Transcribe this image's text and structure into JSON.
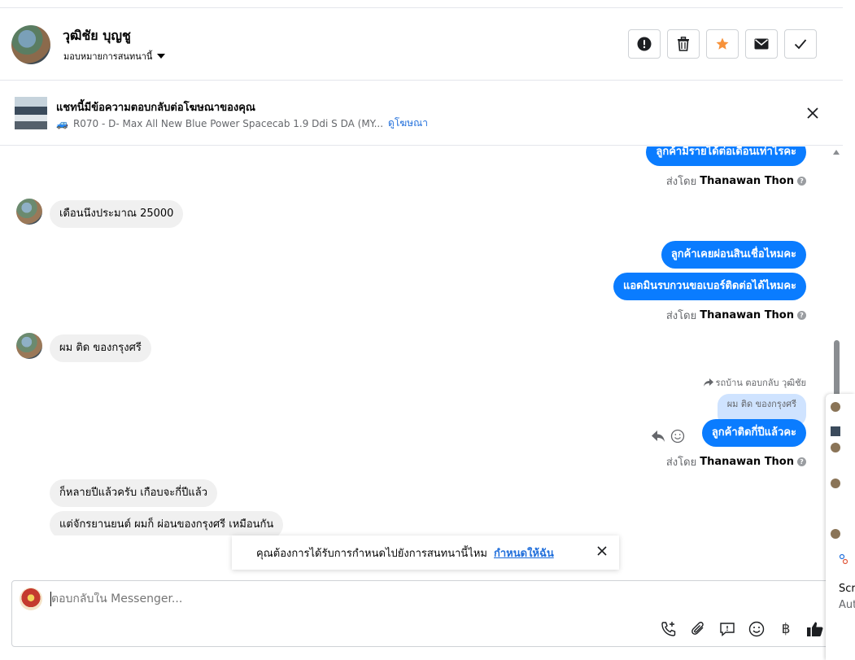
{
  "header": {
    "contact_name": "วุฒิชัย บุญชู",
    "assign_label": "มอบหมายการสนทนานี้",
    "actions": [
      {
        "name": "report-button",
        "icon": "exclamation-circle-icon"
      },
      {
        "name": "delete-button",
        "icon": "trash-icon"
      },
      {
        "name": "star-button",
        "icon": "star-icon"
      },
      {
        "name": "mark-unread-button",
        "icon": "envelope-icon"
      },
      {
        "name": "done-button",
        "icon": "check-icon"
      }
    ]
  },
  "ad_banner": {
    "title": "แชทนี้มีข้อความตอบกลับต่อโฆษณาของคุณ",
    "ad_text": "R070 - D- Max All New Blue Power Spacecab 1.9 Ddi S DA (MY...",
    "view_ad_link": "ดูโฆษณา"
  },
  "messages": {
    "m1_out": "ลูกค้ามีรายได้ต่อเดือนเท่าไรคะ",
    "sent_by_prefix": "ส่งโดย",
    "sent_by_name": "Thanawan Thon",
    "m2_in": "เดือนนึงประมาณ 25000",
    "m3_out": "ลูกค้าเคยผ่อนสินเชื่อไหมคะ",
    "m4_out": "แอดมินรบกวนขอเบอร์ติดต่อได้ไหมคะ",
    "m5_in": "ผม ติด ของกรุงศรี",
    "reply_label": "รถบ้าน ตอบกลับ วุฒิชัย",
    "quoted_text": "ผม ติด ของกรุงศรี",
    "m6_out": "ลูกค้าติดกี่ปีแล้วคะ",
    "m7_in": "ก็หลายปีแล้วครับ เกือบจะกี่ปีแล้ว",
    "m8_in": "แต่จักรยานยนต์ ผมก็ ผ่อนของกรุงศรี เหมือนกัน"
  },
  "toast": {
    "text": "คุณต้องการได้รับการกำหนดไปยังการสนทนานี้ไหม",
    "link": "กำหนดให้ฉัน"
  },
  "composer": {
    "placeholder": "ตอบกลับใน Messenger...",
    "tools": [
      "call-plus-icon",
      "paperclip-icon",
      "saved-reply-icon",
      "emoji-icon",
      "baht-icon",
      "thumbs-up-icon"
    ],
    "baht_symbol": "฿"
  },
  "side_panel": {
    "label1": "Scre",
    "label2": "Aut"
  },
  "colors": {
    "accent_blue": "#0a7cff",
    "link_blue": "#216fdb",
    "star_orange": "#f7923a",
    "incoming_bg": "#f0f0f0",
    "quote_bg": "#cfe3ff"
  }
}
